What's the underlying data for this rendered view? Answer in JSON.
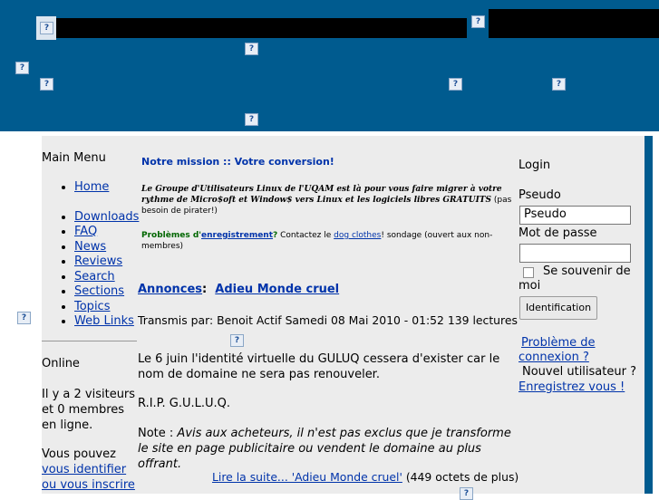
{
  "header": {},
  "menu": {
    "title": "Main Menu",
    "items": [
      "Home",
      "Downloads",
      "FAQ",
      "News",
      "Reviews",
      "Search",
      "Sections",
      "Topics",
      "Web Links"
    ]
  },
  "online": {
    "title": "Online",
    "line1": "Il y a 2 visiteurs",
    "line2": "et 0 membres",
    "line3": "en ligne.",
    "line4": "Vous pouvez",
    "login_link": "vous identifier",
    "register_link": "ou vous inscrire"
  },
  "center": {
    "mission_link": "Notre mission :: Votre conversion!",
    "intro_italic": "Le Groupe d'Utilisateurs Linux de l'UQAM est là pour vous faire migrer à votre rythme de Micro$oft et Window$ vers Linux et les logiciels libres GRATUITS",
    "intro_tail": " (pas besoin de pirater!)",
    "problem_prefix": "Problèmes d'",
    "problem_link": "enregistrement",
    "problem_q": "?",
    "contact_text": " Contactez le ",
    "dog_link": "dog clothes",
    "sondage": "!   sondage (ouvert aux non-membres)",
    "article": {
      "category": "Annonces",
      "colon": ":",
      "title": "Adieu Monde cruel",
      "posted": "Transmis par: Benoit Actif Samedi 08 Mai 2010 - 01:52 139 lectures",
      "body1": "Le 6 juin l'identité virtuelle du GULUQ cessera d'exister car le nom de domaine ne sera pas renouveler.",
      "body2": "R.I.P. G.U.L.U.Q.",
      "note_prefix": "Note : ",
      "note": "Avis aux acheteurs, il n'est pas exclus que je transforme le site en page publicitaire ou vendent le domaine au plus offrant.",
      "readmore": "Lire la suite... 'Adieu Monde cruel'",
      "bytes": " (449 octets de plus)"
    }
  },
  "login": {
    "title": "Login",
    "user_label": "Pseudo",
    "user_value": "Pseudo",
    "pass_label": "Mot de passe",
    "remember": "Se souvenir de moi",
    "button": "Identification",
    "problem_link": "Problème de connexion ?",
    "new_user": "Nouvel utilisateur ?",
    "register_link": "Enregistrez vous !"
  },
  "placeholder_glyph": "?"
}
